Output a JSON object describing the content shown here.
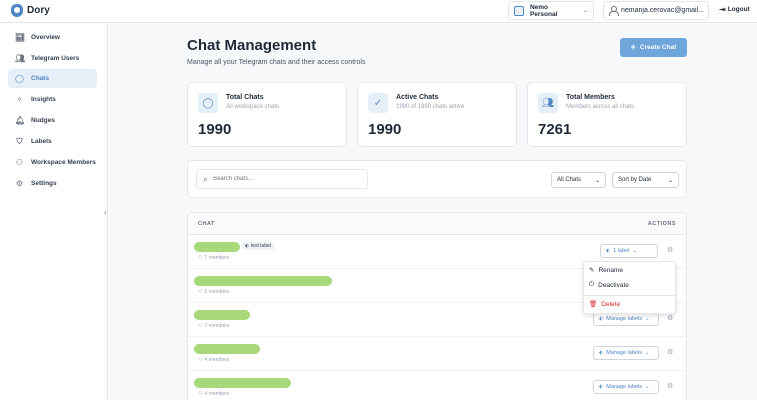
{
  "app": {
    "name": "Dory"
  },
  "header": {
    "workspace": "Nemo Personal",
    "user_email": "nemanja.cerovac@gmail...",
    "logout_label": "Logout"
  },
  "sidebar": {
    "items": [
      {
        "label": "Overview",
        "icon": "chart-icon"
      },
      {
        "label": "Telegram Users",
        "icon": "users-icon"
      },
      {
        "label": "Chats",
        "icon": "chat-bubble-icon",
        "active": true
      },
      {
        "label": "Insights",
        "icon": "sparkle-icon"
      },
      {
        "label": "Nudges",
        "icon": "bell-icon"
      },
      {
        "label": "Labels",
        "icon": "shield-icon"
      },
      {
        "label": "Workspace Members",
        "icon": "user-plus-icon"
      },
      {
        "label": "Settings",
        "icon": "gear-icon"
      }
    ]
  },
  "page": {
    "title": "Chat Management",
    "subtitle": "Manage all your Telegram chats and their access controls",
    "create_label": "Create Chat"
  },
  "stats": [
    {
      "title": "Total Chats",
      "subtitle": "All workspace chats",
      "value": "1990",
      "icon": "chat-bubble-icon"
    },
    {
      "title": "Active Chats",
      "subtitle": "1990 of 1990 chats active",
      "value": "1990",
      "icon": "check-circle-icon"
    },
    {
      "title": "Total Members",
      "subtitle": "Members across all chats",
      "value": "7261",
      "icon": "users-icon"
    }
  ],
  "filters": {
    "search_placeholder": "Search chats...",
    "status_select": "All Chats",
    "sort_select": "Sort by Date"
  },
  "table": {
    "col_chat": "CHAT",
    "col_actions": "ACTIONS",
    "rows": [
      {
        "members": "7 members",
        "tag": "test label",
        "labels_btn": "1 label"
      },
      {
        "members": "0 members"
      },
      {
        "members": "7 members",
        "labels_btn": "Manage labels"
      },
      {
        "members": "4 members",
        "labels_btn": "Manage labels"
      },
      {
        "members": "4 members",
        "labels_btn": "Manage labels"
      }
    ]
  },
  "context_menu": {
    "rename": "Rename",
    "deactivate": "Deactivate",
    "delete": "Delete"
  },
  "colors": {
    "accent": "#4f86c6",
    "create_button": "#6ea5db",
    "redacted_name": "#a8d87a",
    "danger": "#dc2626"
  }
}
